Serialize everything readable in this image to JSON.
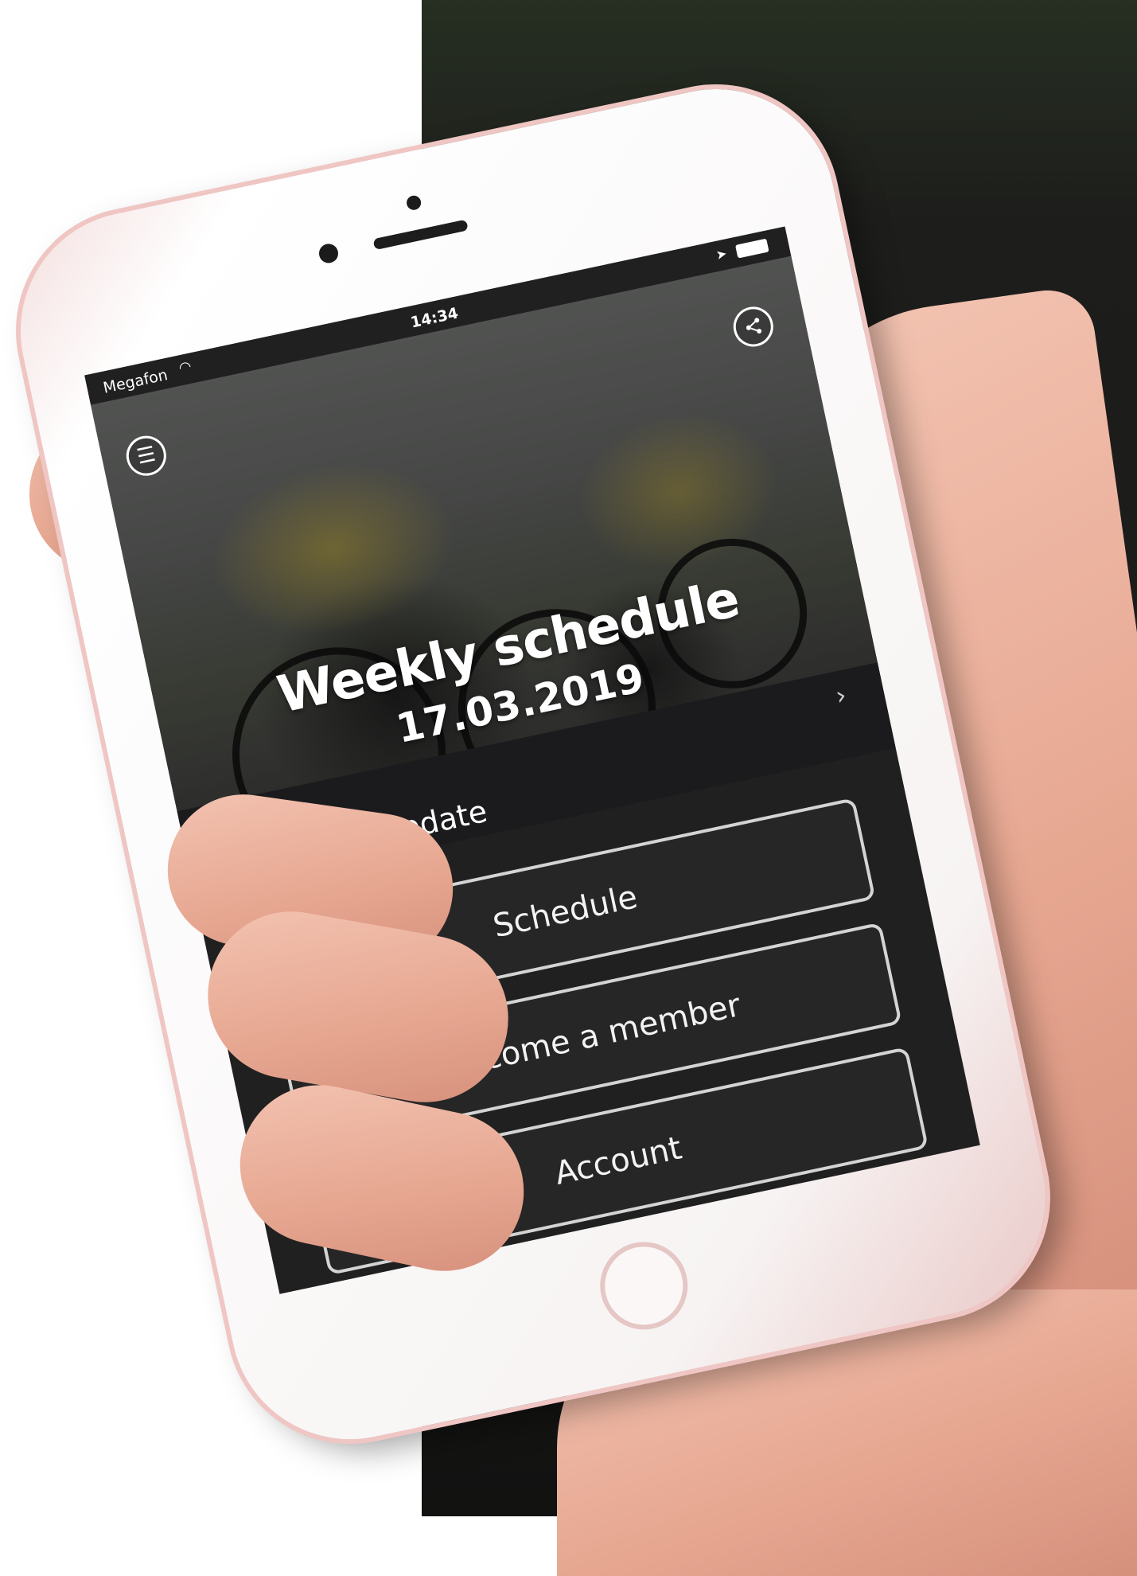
{
  "status_bar": {
    "carrier": "Megafon",
    "time": "14:34"
  },
  "hero": {
    "title": "Weekly schedule",
    "date": "17.03.2019"
  },
  "update_row": {
    "label": "Schedule update",
    "chevron": "›"
  },
  "buttons": {
    "schedule": "Schedule",
    "member": "Become a member",
    "account": "Account"
  },
  "icons": {
    "menu": "menu-icon",
    "share": "share-icon",
    "wifi": "wifi-icon",
    "location": "location-arrow-icon",
    "battery": "battery-icon"
  },
  "colors": {
    "screen_background": "#202020",
    "button_border": "#d4d4d4",
    "text": "#ffffff",
    "phone_frame": "#f7f3f3",
    "phone_accent": "#efc6c3"
  }
}
